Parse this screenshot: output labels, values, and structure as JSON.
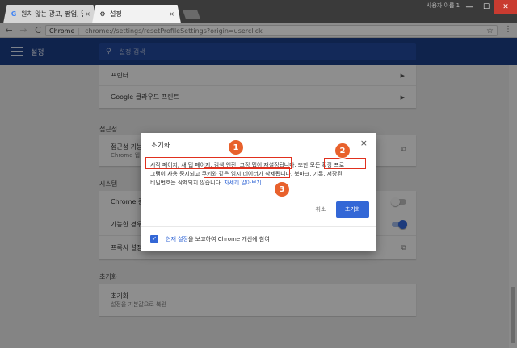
{
  "browser": {
    "tabs": [
      {
        "title": "원치 않는 광고, 팝업, 멀",
        "icon": "G",
        "close": "×"
      },
      {
        "title": "설정",
        "icon": "⚙",
        "close": "×"
      }
    ],
    "window_controls": {
      "minimize": "—",
      "maximize": "☐",
      "close": "✕"
    },
    "user_badge": "사용자 이름 1",
    "omnibox": {
      "security_label": "Chrome",
      "url": "chrome://settings/resetProfileSettings?origin=userclick"
    },
    "star": "☆",
    "menu": "⋮",
    "back": "←",
    "forward": "→",
    "reload": "C"
  },
  "settings_header": {
    "title": "설정",
    "search_placeholder": "설정 검색",
    "search_icon": "⚲"
  },
  "background": {
    "printing_card": [
      {
        "label": "프린터",
        "arrow": "▶"
      },
      {
        "label": "Google 클라우드 프린트",
        "arrow": "▶"
      }
    ],
    "accessibility_section": "접근성",
    "accessibility_row": {
      "label": "접근성 기능",
      "sub": "Chrome 웹",
      "ext": "⧉"
    },
    "system_section": "시스템",
    "system_rows": [
      {
        "label": "Chrome 종"
      },
      {
        "label": "가능한 경우"
      },
      {
        "label": "프록시 설정",
        "ext": "⧉"
      }
    ],
    "reset_section": "초기화",
    "reset_row": {
      "label": "초기화",
      "sub": "설정을 기본값으로 복원"
    }
  },
  "dialog": {
    "title": "초기화",
    "close": "×",
    "body_line1": "시작 페이지, 새 탭 페이지, 검색 엔진, 고정 탭이 재설정됩니다. 또한 모든 확장 프로",
    "body_line2": "그램이 사용 중지되고 쿠키와 같은 임시 데이터가 삭제됩니다. 북마크, 기록, 저장된",
    "body_line3": "비밀번호는 삭제되지 않습니다.",
    "learn_more": "자세히 알아보기",
    "cancel_label": "취소",
    "reset_label": "초기화",
    "footer_link": "현재 설정",
    "footer_text": "을 보고하여 Chrome 개선에 참여",
    "checkbox_mark": "✓"
  },
  "annotations": [
    "1",
    "2",
    "3"
  ],
  "colors": {
    "header": "#1a3d84",
    "accent": "#3367d6",
    "annotation": "#e0301e"
  }
}
